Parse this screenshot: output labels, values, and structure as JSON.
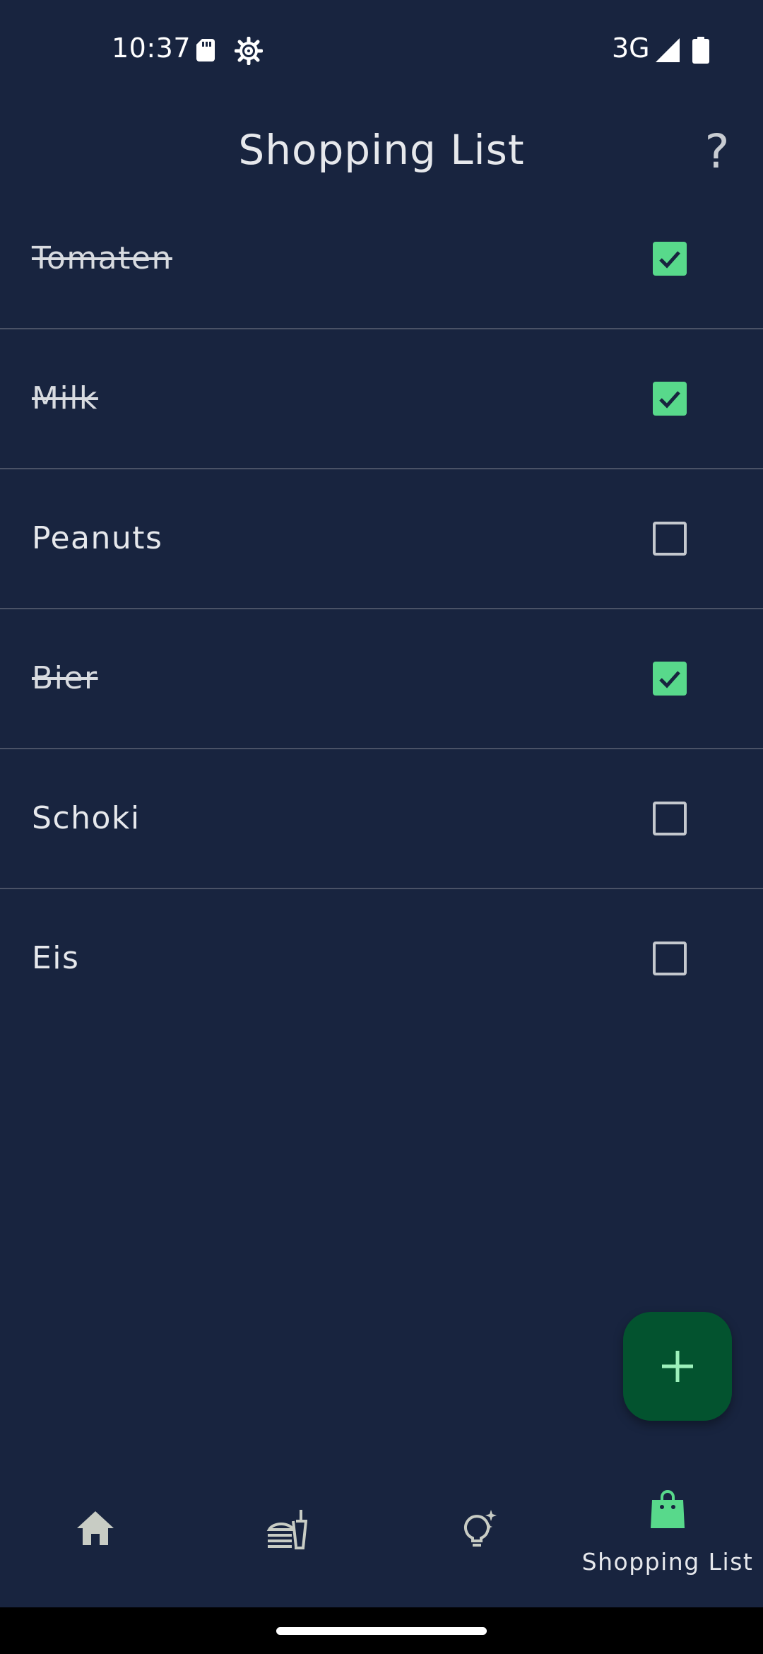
{
  "status_bar": {
    "time": "10:37",
    "network": "3G"
  },
  "app_bar": {
    "title": "Shopping List",
    "help_label": "?"
  },
  "items": [
    {
      "label": "Tomaten",
      "checked": true
    },
    {
      "label": "Milk",
      "checked": true
    },
    {
      "label": "Peanuts",
      "checked": false
    },
    {
      "label": "Bier",
      "checked": true
    },
    {
      "label": "Schoki",
      "checked": false
    },
    {
      "label": "Eis",
      "checked": false
    }
  ],
  "fab": {
    "icon": "plus-icon"
  },
  "bottom_nav": {
    "items": [
      {
        "icon": "home-icon",
        "label": ""
      },
      {
        "icon": "dining-icon",
        "label": ""
      },
      {
        "icon": "lightbulb-sparkle-icon",
        "label": ""
      },
      {
        "icon": "shopping-bag-icon",
        "label": "Shopping List",
        "active": true
      }
    ]
  },
  "colors": {
    "background": "#18243f",
    "accent": "#58d98b",
    "fab": "#03532f",
    "divider": "#4a5266"
  }
}
